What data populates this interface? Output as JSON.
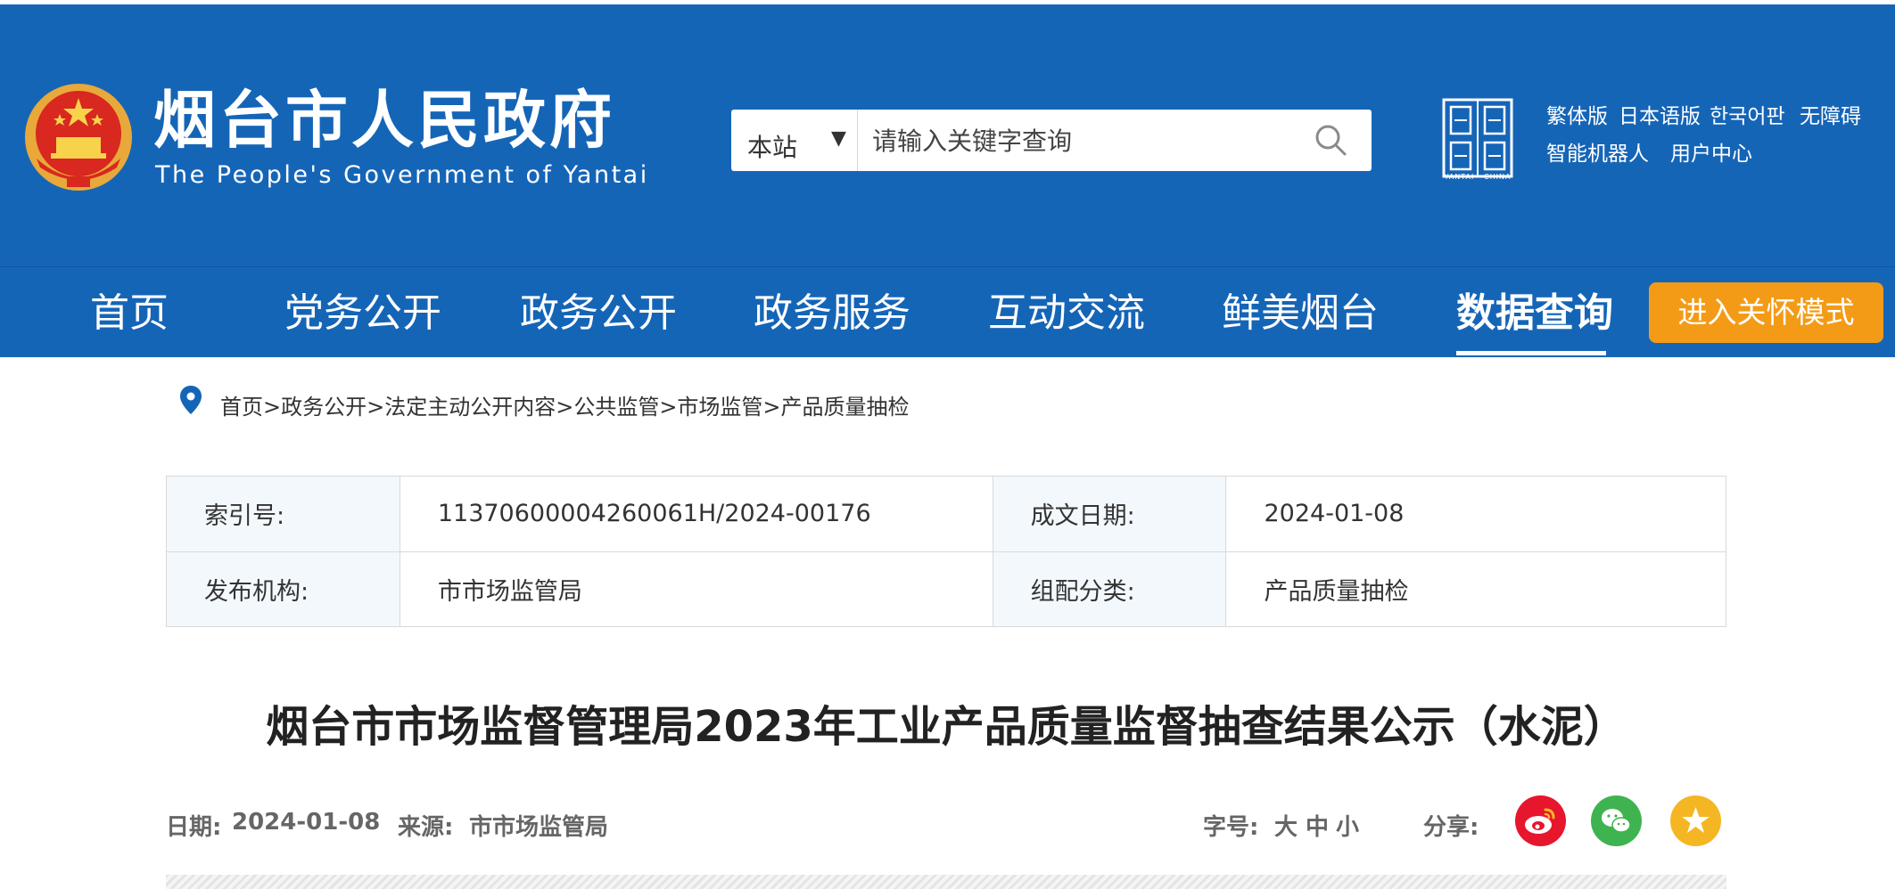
{
  "colors": {
    "brand_blue": "#1565b7",
    "care_orange": "#f39b17",
    "weibo_red": "#e6162d",
    "wechat_green": "#3fb34f",
    "fav_gold": "#f5b624"
  },
  "header": {
    "title": "烟台市人民政府",
    "subtitle": "The People's Government of Yantai",
    "city_logo_caption": "YANTAI · CHINA"
  },
  "search": {
    "scope": "本站",
    "placeholder": "请输入关键字查询",
    "icon": "search-icon"
  },
  "toplinks": {
    "traditional": "繁体版",
    "japanese": "日本语版",
    "korean": "한국어판",
    "accessible": "无障碍",
    "robot": "智能机器人",
    "user_center": "用户中心"
  },
  "nav": {
    "items": [
      "首页",
      "党务公开",
      "政务公开",
      "政务服务",
      "互动交流",
      "鲜美烟台",
      "数据查询"
    ],
    "active_index": 6,
    "care_button": "进入关怀模式"
  },
  "breadcrumb": "首页>政务公开>法定主动公开内容>公共监管>市场监管>产品质量抽检",
  "meta": {
    "index_label": "索引号:",
    "index_value": "11370600004260061H/2024-00176",
    "date_label": "成文日期:",
    "date_value": "2024-01-08",
    "publisher_label": "发布机构:",
    "publisher_value": "市市场监管局",
    "category_label": "组配分类:",
    "category_value": "产品质量抽检"
  },
  "article": {
    "title": "烟台市市场监督管理局2023年工业产品质量监督抽查结果公示（水泥）",
    "date_label": "日期:",
    "date_value": "2024-01-08",
    "source_label": "来源:",
    "source_value": "市市场监管局",
    "font_label": "字号:",
    "font_large": "大",
    "font_medium": "中",
    "font_small": "小",
    "share_label": "分享:"
  }
}
